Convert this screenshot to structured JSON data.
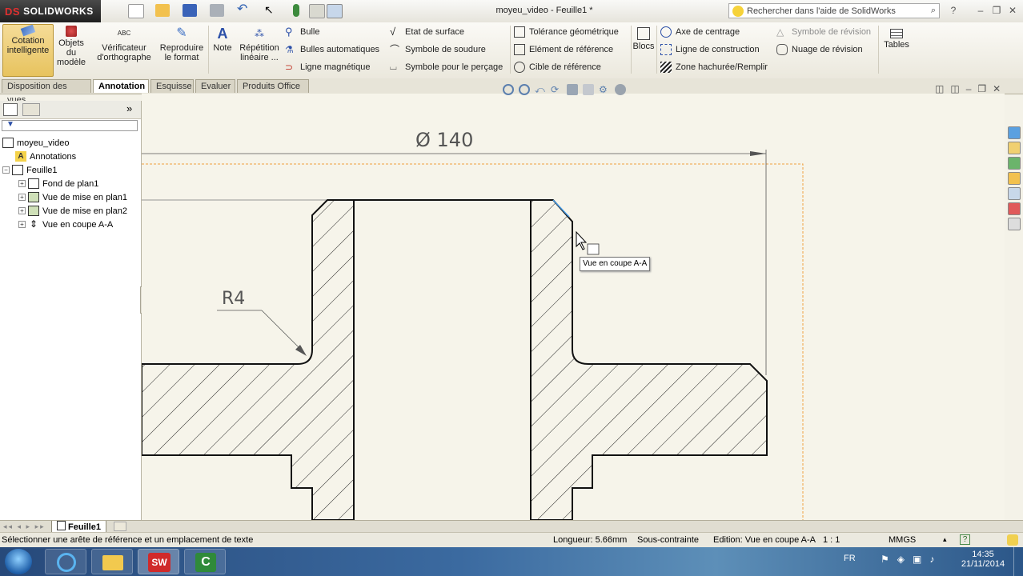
{
  "app": {
    "logo_text": "SOLIDWORKS",
    "logo_prefix": "DS",
    "document_title": "moyeu_video - Feuille1 *",
    "help_search_placeholder": "Rechercher dans l'aide de SolidWorks"
  },
  "ribbon": {
    "smart_dimension": "Cotation intelligente",
    "model_items": "Objets du modèle",
    "spell_checker": "Vérificateur d'orthographe",
    "format_painter": "Reproduire le format",
    "note": "Note",
    "linear_pattern": "Répétition linéaire ...",
    "balloon": "Bulle",
    "auto_balloon": "Bulles automatiques",
    "magnetic_line": "Ligne magnétique",
    "surface_finish": "Etat de surface",
    "weld_symbol": "Symbole de soudure",
    "hole_callout": "Symbole pour le perçage",
    "geometric_tolerance": "Tolérance géométrique",
    "datum_feature": "Elément de référence",
    "datum_target": "Cible de référence",
    "blocks": "Blocs",
    "centerline": "Axe de centrage",
    "construction_line": "Ligne de construction",
    "hatch_fill": "Zone hachurée/Remplir",
    "revision_symbol": "Symbole de révision",
    "revision_cloud": "Nuage de révision",
    "tables": "Tables"
  },
  "tabs": [
    {
      "label": "Disposition des vues",
      "active": false
    },
    {
      "label": "Annotation",
      "active": true
    },
    {
      "label": "Esquisse",
      "active": false
    },
    {
      "label": "Evaluer",
      "active": false
    },
    {
      "label": "Produits Office",
      "active": false
    }
  ],
  "tree": {
    "root": "moyeu_video",
    "annotations": "Annotations",
    "sheet": "Feuille1",
    "items": [
      "Fond de plan1",
      "Vue de mise en plan1",
      "Vue de mise en plan2",
      "Vue en coupe A-A"
    ]
  },
  "drawing": {
    "diameter_dim": "140",
    "diameter_symbol": "Ø",
    "radius_dim": "R4",
    "tooltip": "Vue en coupe A-A"
  },
  "sheet_tab": "Feuille1",
  "status": {
    "message": "Sélectionner une arête de référence et un emplacement de texte",
    "length": "Longueur: 5.66mm",
    "constraint": "Sous-contrainte",
    "edition": "Edition: Vue en coupe A-A",
    "scale": "1 : 1",
    "units": "MMGS"
  },
  "taskbar": {
    "language": "FR",
    "time": "14:35",
    "date": "21/11/2014"
  },
  "colors": {
    "logo_red": "#e03030",
    "selected_button": "#f0d27a",
    "active_tab": "#ffffff",
    "orange_border": "#f0a040",
    "taskbar": "#3b6aa0"
  }
}
